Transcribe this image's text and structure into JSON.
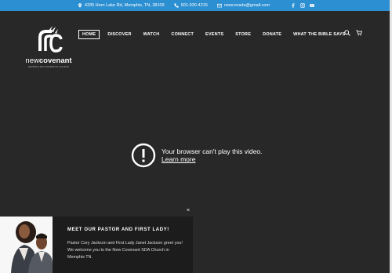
{
  "topbar": {
    "address": "4335 Horn Lake Rd, Memphis, TN, 38109",
    "phone": "901-930-4215",
    "email": "newcovsda@gmail.com",
    "social_icons": [
      "facebook-icon",
      "instagram-icon",
      "youtube-icon"
    ]
  },
  "logo": {
    "word_light": "new",
    "word_bold": "covenant",
    "subtitle": "SEVENTH-DAY ADVENTIST CHURCH"
  },
  "nav": {
    "items": [
      "HOME",
      "DISCOVER",
      "WATCH",
      "CONNECT",
      "EVENTS",
      "STORE",
      "DONATE",
      "WHAT THE BIBLE SAYS"
    ],
    "active": "HOME",
    "icons": [
      "search-icon",
      "cart-icon"
    ]
  },
  "player": {
    "message": "Your browser can't play this video.",
    "link": "Learn more"
  },
  "popup": {
    "close": "×",
    "title": "MEET OUR PASTOR AND FIRST LADY!",
    "body": "Pastor Cory Jackson and First Lady Janet Jackson greet you! We welcome you to the New Covenant SDA Church in Memphis TN."
  },
  "colors": {
    "topbar": "#2c8fd1",
    "hero_background": "#282828",
    "popup_background": "#1c1c1c"
  }
}
